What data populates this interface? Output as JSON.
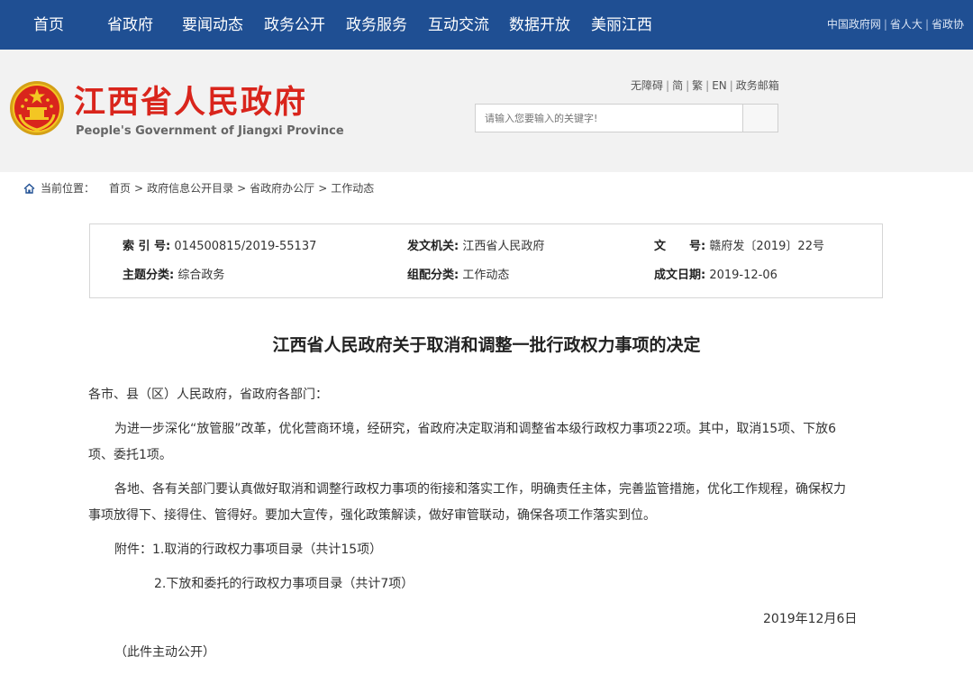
{
  "nav": {
    "items": [
      "首页",
      "省政府",
      "要闻动态",
      "政务公开",
      "政务服务",
      "互动交流",
      "数据开放",
      "美丽江西"
    ],
    "right_links": [
      "中国政府网",
      "省人大",
      "省政协"
    ]
  },
  "header": {
    "title": "江西省人民政府",
    "subtitle": "People's Government of Jiangxi Province",
    "top_links": [
      "无障碍",
      "简",
      "繁",
      "EN",
      "政务邮箱"
    ],
    "search_placeholder": "请输入您要输入的关键字!"
  },
  "breadcrumb": {
    "label": "当前位置：",
    "items": [
      "首页",
      "政府信息公开目录",
      "省政府办公厅",
      "工作动态"
    ],
    "separator": ">"
  },
  "meta": {
    "index_label": "索 引 号:",
    "index_value": "014500815/2019-55137",
    "issuer_label": "发文机关:",
    "issuer_value": "江西省人民政府",
    "doc_no_label": "文　　号:",
    "doc_no_value": "赣府发〔2019〕22号",
    "topic_label": "主题分类:",
    "topic_value": "综合政务",
    "category_label": "组配分类:",
    "category_value": "工作动态",
    "date_label": "成文日期:",
    "date_value": "2019-12-06"
  },
  "article": {
    "title": "江西省人民政府关于取消和调整一批行政权力事项的决定",
    "salutation": "各市、县（区）人民政府，省政府各部门：",
    "para1_line1": "为进一步深化“放管服”改革，优化营商环境，经研究，省政府决定取消和调整省本级行政权力事项22项。其中，取消15项、下放6",
    "para1_line2": "项、委托1项。",
    "para2_line1": "各地、各有关部门要认真做好取消和调整行政权力事项的衔接和落实工作，明确责任主体，完善监管措施，优化工作规程，确保权力",
    "para2_line2": "事项放得下、接得住、管得好。要加大宣传，强化政策解读，做好审管联动，确保各项工作落实到位。",
    "attachment1": "附件：1.取消的行政权力事项目录（共计15项）",
    "attachment2": "2.下放和委托的行政权力事项目录（共计7项）",
    "date": "2019年12月6日",
    "note": "（此件主动公开）"
  },
  "colors": {
    "nav_bg": "#1f4f93",
    "title_red": "#d9251c",
    "header_bg": "#f2f2f2"
  }
}
